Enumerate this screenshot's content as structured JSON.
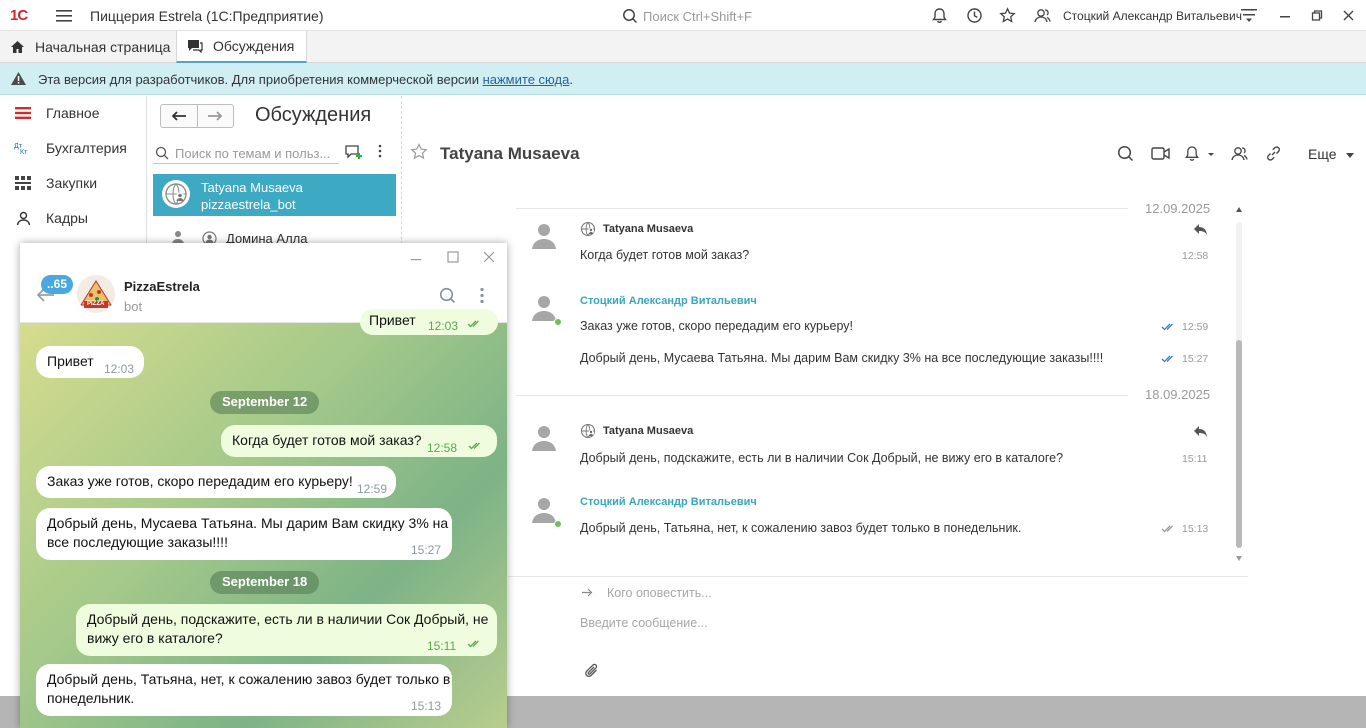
{
  "app": {
    "logo": "1С",
    "title": "Пиццерия Estrela  (1С:Предприятие)",
    "search_placeholder": "Поиск Ctrl+Shift+F",
    "user": "Стоцкий Александр Витальевич"
  },
  "tabs": [
    {
      "label": "Начальная страница"
    },
    {
      "label": "Обсуждения"
    }
  ],
  "banner": {
    "text": "Эта версия для разработчиков. Для приобретения коммерческой версии ",
    "link": "нажмите сюда",
    "suffix": "."
  },
  "sidebar": {
    "items": [
      {
        "label": "Главное"
      },
      {
        "label": "Бухгалтерия"
      },
      {
        "label": "Закупки"
      },
      {
        "label": "Кадры"
      }
    ]
  },
  "page": {
    "title": "Обсуждения"
  },
  "list": {
    "search_placeholder": "Поиск по темам и польз...",
    "conversations": [
      {
        "name": "Tatyana Musaeva",
        "sub": "pizzaestrela_bot"
      },
      {
        "name": "Домина Алла"
      }
    ]
  },
  "chat": {
    "title": "Tatyana Musaeva",
    "more_label": "Еще",
    "notify_placeholder": "Кого оповестить...",
    "message_placeholder": "Введите сообщение...",
    "groups": [
      {
        "date": "12.09.2025",
        "messages": [
          {
            "author": "Tatyana Musaeva",
            "text": "Когда будет готов мой заказ?",
            "time": "12:58"
          },
          {
            "author": "Стоцкий Александр Витальевич",
            "text": "Заказ уже готов, скоро передадим его курьеру!",
            "time": "12:59"
          },
          {
            "text": "Добрый день, Мусаева Татьяна. Мы дарим Вам скидку 3% на все последующие заказы!!!!",
            "time": "15:27"
          }
        ]
      },
      {
        "date": "18.09.2025",
        "messages": [
          {
            "author": "Tatyana Musaeva",
            "text": "Добрый день, подскажите, есть ли в наличии Сок Добрый, не вижу его в каталоге?",
            "time": "15:11"
          },
          {
            "author": "Стоцкий Александр Витальевич",
            "text": "Добрый день, Татьяна, нет, к сожалению завоз будет только в понедельник.",
            "time": "15:13"
          }
        ]
      }
    ]
  },
  "telegram": {
    "unread": "..65",
    "bot_name": "PizzaEstrela",
    "bot_status": "bot",
    "avatar_text": "PIZZA",
    "partial_text": "Привет",
    "partial_time": "12:03",
    "bubbles": [
      {
        "text": "Привет",
        "time": "12:03"
      },
      {
        "date": "September 12"
      },
      {
        "text": "Когда будет готов мой заказ?",
        "time": "12:58"
      },
      {
        "text": "Заказ уже готов, скоро передадим его курьеру!",
        "time": "12:59"
      },
      {
        "text1": "Добрый день, Мусаева Татьяна. Мы дарим Вам скидку 3% на",
        "text2": "все последующие заказы!!!!",
        "time": "15:27"
      },
      {
        "date": "September 18"
      },
      {
        "text1": "Добрый день, подскажите, есть ли в наличии Сок Добрый, не",
        "text2": "вижу его в каталоге?",
        "time": "15:11"
      },
      {
        "text1": "Добрый день, Татьяна, нет, к сожалению завоз будет только в",
        "text2": "понедельник.",
        "time": "15:13"
      }
    ]
  }
}
